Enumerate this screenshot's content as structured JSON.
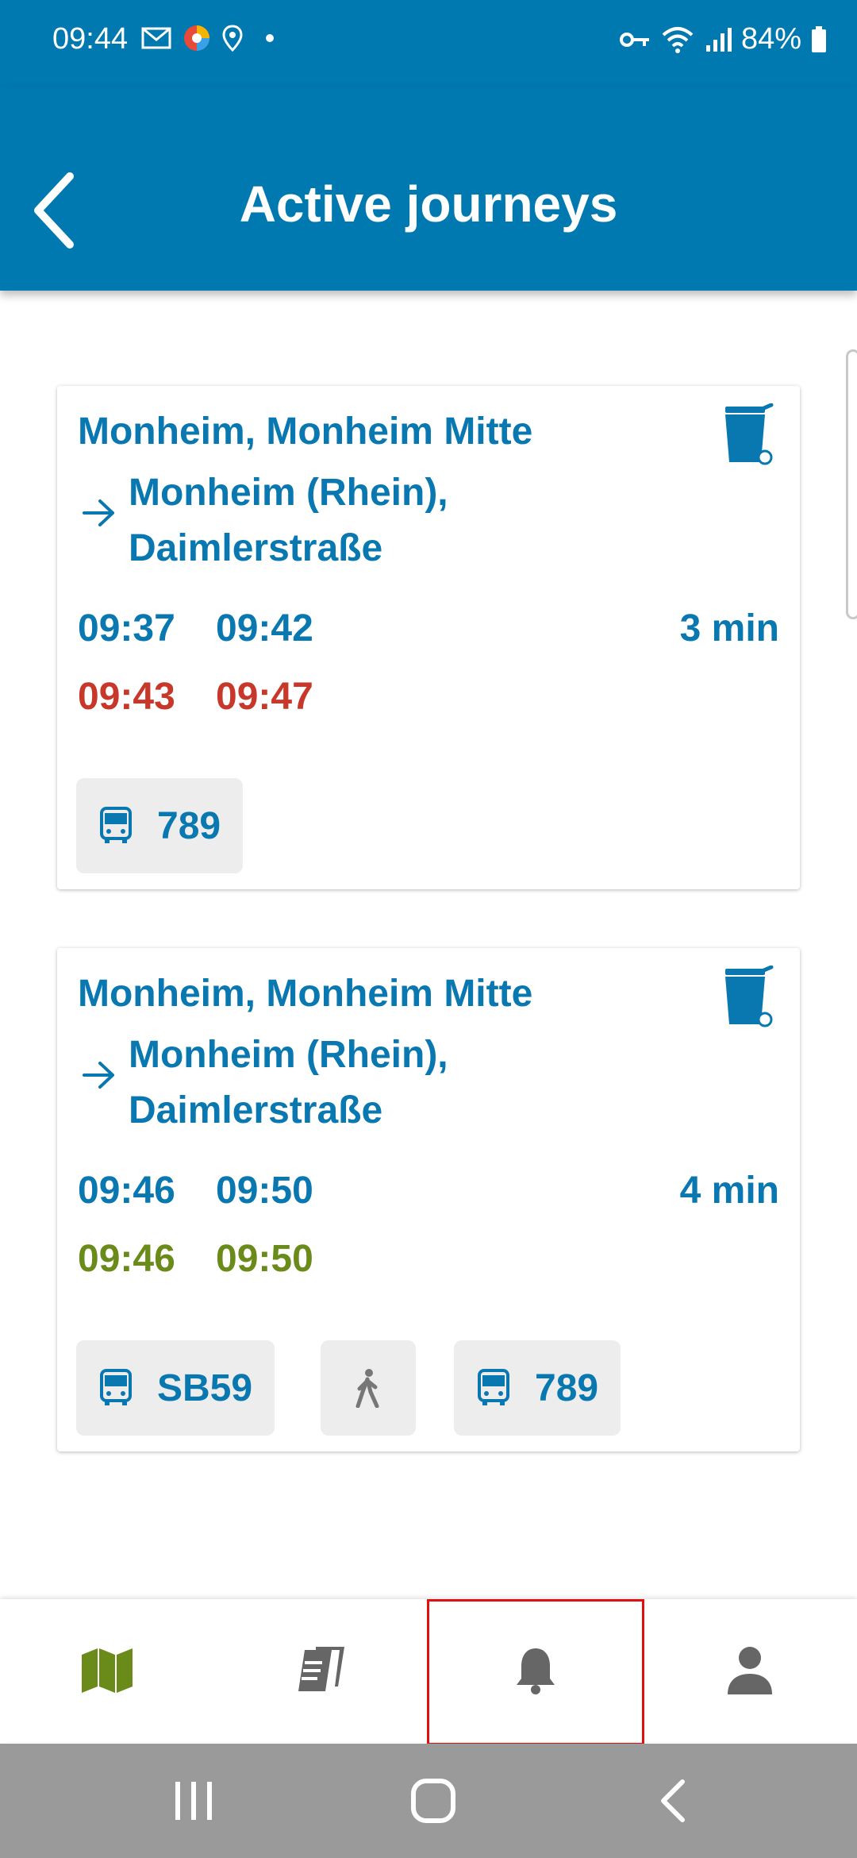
{
  "status_bar": {
    "time": "09:44",
    "battery": "84%"
  },
  "header": {
    "title": "Active journeys"
  },
  "journeys": [
    {
      "origin": "Monheim, Monheim Mitte",
      "destination": "Monheim (Rhein), Daimlerstraße",
      "planned_departure": "09:37",
      "planned_arrival": "09:42",
      "realtime_departure": "09:43",
      "realtime_arrival": "09:47",
      "realtime_status_color": "#c8382a",
      "duration": "3 min",
      "legs": [
        {
          "type": "bus-icon",
          "label": "789"
        }
      ]
    },
    {
      "origin": "Monheim, Monheim Mitte",
      "destination": "Monheim (Rhein), Daimlerstraße",
      "planned_departure": "09:46",
      "planned_arrival": "09:50",
      "realtime_departure": "09:46",
      "realtime_arrival": "09:50",
      "realtime_status_color": "#6a8a1a",
      "duration": "4 min",
      "legs": [
        {
          "type": "bus-icon",
          "label": "SB59"
        },
        {
          "type": "walk-icon",
          "label": ""
        },
        {
          "type": "bus-icon",
          "label": "789"
        }
      ]
    }
  ],
  "bottom_nav": {
    "items": [
      {
        "name": "map-icon",
        "active": true
      },
      {
        "name": "tickets-icon",
        "active": false
      },
      {
        "name": "bell-icon",
        "active": false,
        "highlighted": true
      },
      {
        "name": "profile-icon",
        "active": false
      }
    ]
  },
  "colors": {
    "brand": "#0078b0",
    "text_blue": "#0a78b0",
    "late": "#c8382a",
    "on_time": "#6a8a1a",
    "nav_active": "#6a8a1a",
    "nav_inactive": "#666666"
  }
}
